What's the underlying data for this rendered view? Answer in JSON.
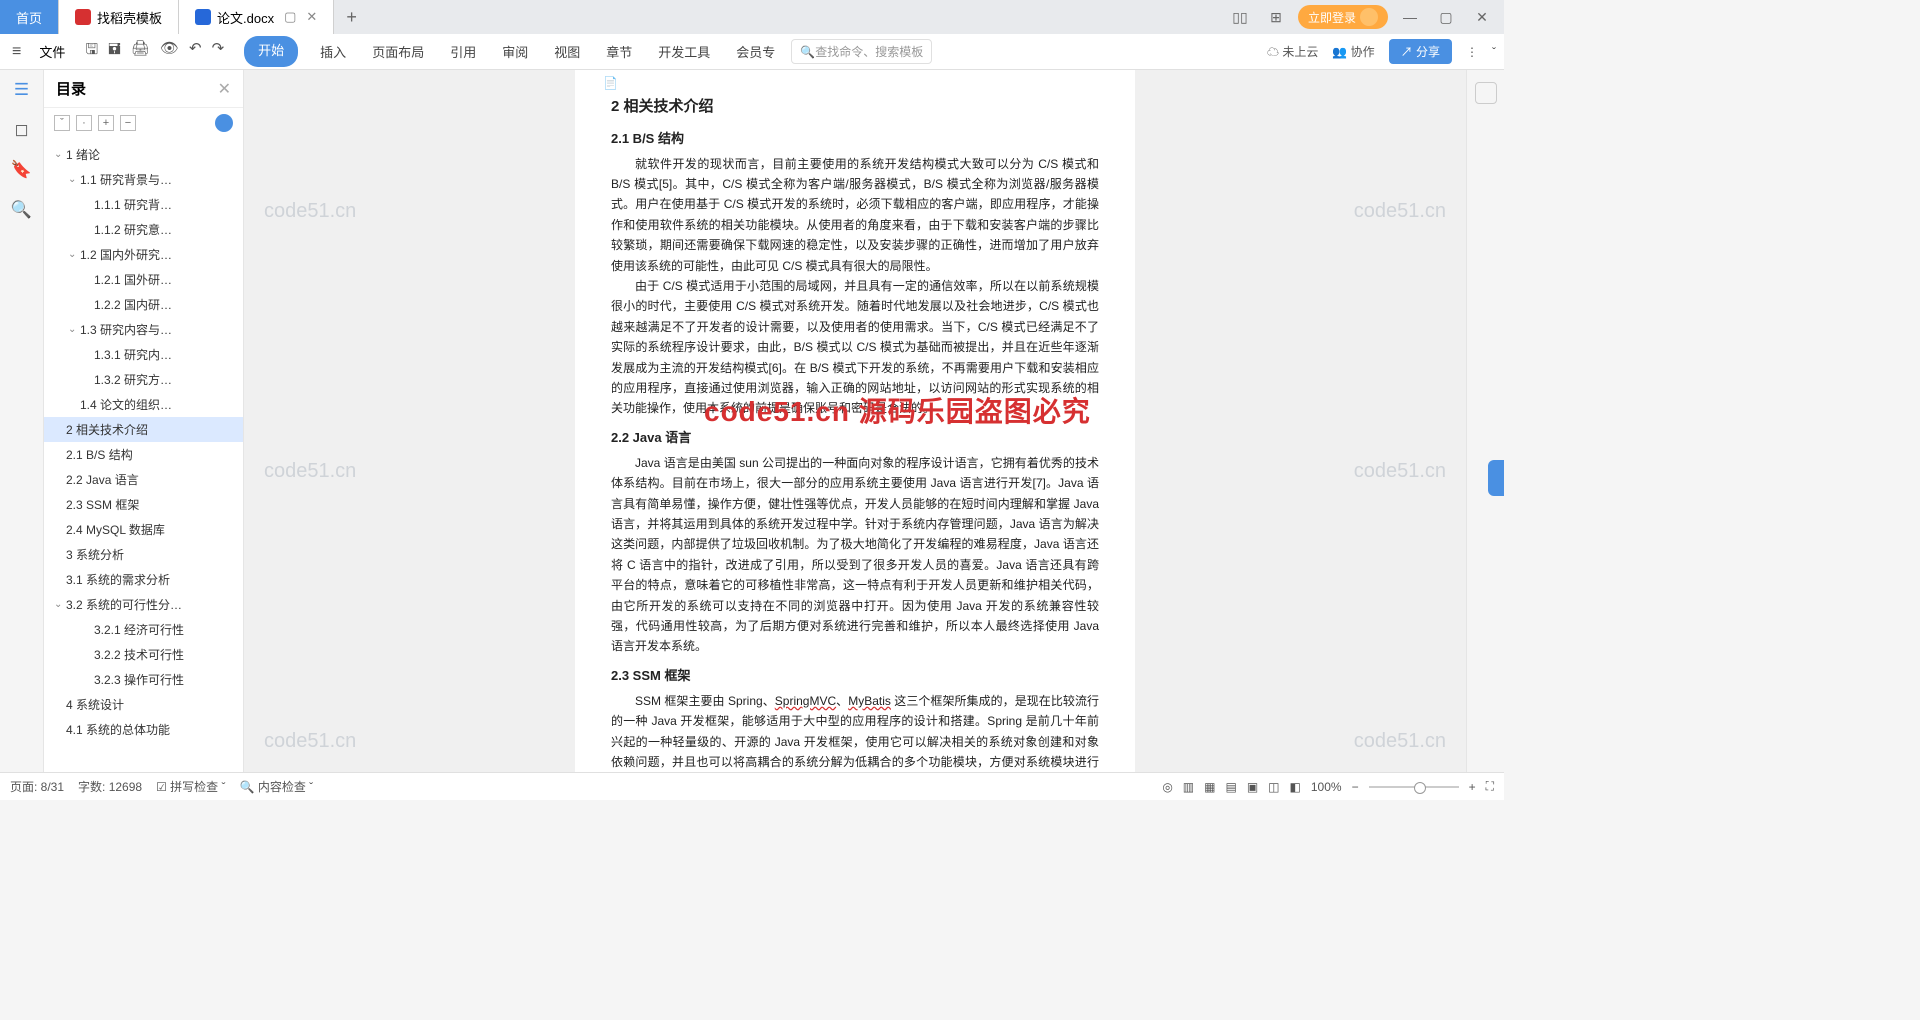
{
  "tabs": {
    "home": "首页",
    "template": "找稻壳模板",
    "doc": "论文.docx"
  },
  "login": "立即登录",
  "ribbon": {
    "file": "文件",
    "tabs": [
      "开始",
      "插入",
      "页面布局",
      "引用",
      "审阅",
      "视图",
      "章节",
      "开发工具",
      "会员专"
    ],
    "search_ph": "查找命令、搜索模板",
    "cloud": "未上云",
    "collab": "协作",
    "share": "分享"
  },
  "outline": {
    "title": "目录",
    "items": [
      {
        "t": "1 绪论",
        "l": 0,
        "c": 1
      },
      {
        "t": "1.1 研究背景与…",
        "l": 1,
        "c": 1
      },
      {
        "t": "1.1.1 研究背…",
        "l": 2
      },
      {
        "t": "1.1.2 研究意…",
        "l": 2
      },
      {
        "t": "1.2 国内外研究…",
        "l": 1,
        "c": 1
      },
      {
        "t": "1.2.1 国外研…",
        "l": 2
      },
      {
        "t": "1.2.2 国内研…",
        "l": 2
      },
      {
        "t": "1.3 研究内容与…",
        "l": 1,
        "c": 1
      },
      {
        "t": "1.3.1 研究内…",
        "l": 2
      },
      {
        "t": "1.3.2 研究方…",
        "l": 2
      },
      {
        "t": "1.4 论文的组织…",
        "l": 1
      },
      {
        "t": "2 相关技术介绍",
        "l": 0,
        "sel": 1
      },
      {
        "t": "2.1 B/S 结构",
        "l": 0
      },
      {
        "t": "2.2 Java 语言",
        "l": 0
      },
      {
        "t": "2.3 SSM 框架",
        "l": 0
      },
      {
        "t": "2.4 MySQL 数据库",
        "l": 0
      },
      {
        "t": "3 系统分析",
        "l": 0
      },
      {
        "t": "3.1 系统的需求分析",
        "l": 0
      },
      {
        "t": "3.2 系统的可行性分…",
        "l": 0,
        "c": 1
      },
      {
        "t": "3.2.1 经济可行性",
        "l": 2
      },
      {
        "t": "3.2.2 技术可行性",
        "l": 2
      },
      {
        "t": "3.2.3 操作可行性",
        "l": 2
      },
      {
        "t": "4 系统设计",
        "l": 0
      },
      {
        "t": "4.1 系统的总体功能",
        "l": 0
      }
    ]
  },
  "doc": {
    "h1": "2 相关技术介绍",
    "s21_h": "2.1 B/S 结构",
    "s21_p1": "就软件开发的现状而言，目前主要使用的系统开发结构模式大致可以分为 C/S 模式和 B/S 模式[5]。其中，C/S 模式全称为客户端/服务器模式，B/S 模式全称为浏览器/服务器模式。用户在使用基于 C/S 模式开发的系统时，必须下载相应的客户端，即应用程序，才能操作和使用软件系统的相关功能模块。从使用者的角度来看，由于下载和安装客户端的步骤比较繁琐，期间还需要确保下载网速的稳定性，以及安装步骤的正确性，进而增加了用户放弃使用该系统的可能性，由此可见 C/S 模式具有很大的局限性。",
    "s21_p2_a": "由于 C/S 模式适用于小范围的局域网，并且具有一定的通信效率，所以在以前系统规模很小的时代，主要使用 C/S 模式对系统开发。随着时代地发展以及社会地进步，C/S 模式也越来越满足不了开发者的设计需要，以及使用者的使用需求。当下，C/S 模式已经满足不了实际的系统程序设计要求，由此，B/S 模式以 C/S 模式为基础而被提出，并且在近些年逐渐发展成为主流的开发结构模式[6]。在 B/S 模式下开发的系统，不再需要用户下载和安装相应的应用程序，直接通过使用浏览器，输入正确的网站地址，以访问网站的形式实现系统的相关功能操作，",
    "s21_p2_b": "使用本系统的前提是确保账号和密码是合法的。",
    "s22_h": "2.2 Java 语言",
    "s22_p": "Java 语言是由美国 sun 公司提出的一种面向对象的程序设计语言，它拥有着优秀的技术体系结构。目前在市场上，很大一部分的应用系统主要使用 Java 语言进行开发[7]。Java 语言具有简单易懂，操作方便，健壮性强等优点，开发人员能够的在短时间内理解和掌握 Java 语言，并将其运用到具体的系统开发过程中学。针对于系统内存管理问题，Java 语言为解决这类问题，内部提供了垃圾回收机制。为了极大地简化了开发编程的难易程度，Java 语言还将 C 语言中的指针，改进成了引用，所以受到了很多开发人员的喜爱。Java 语言还具有跨平台的特点，意味着它的可移植性非常高，这一特点有利于开发人员更新和维护相关代码，由它所开发的系统可以支持在不同的浏览器中打开。因为使用 Java 开发的系统兼容性较强，代码通用性较高，为了后期方便对系统进行完善和维护，所以本人最终选择使用 Java 语言开发本系统。",
    "s23_h": "2.3 SSM 框架",
    "s23_p_a": "SSM 框架主要由 Spring、",
    "s23_w1": "SpringMVC",
    "s23_sep": "、",
    "s23_w2": "MyBatis",
    "s23_p_b": " 这三个框架所集成的，是现在比较流行的一种 Java 开发框架，能够适用于大中型的应用程序的设计和搭建。Spring 是前几十年前兴起的一种轻量级的、开源的 Java 开发框架，使用它可以解决相关的系统对象创建和对象依赖问题，并且也可以将高耦合的系统分解为低耦合的多个功能模块，方便对系统模块进行明确的分工，对功能代码进行理解和"
  },
  "overlay": "code51.cn 源码乐园盗图必究",
  "watermark": "code51.cn",
  "status": {
    "page": "页面: 8/31",
    "words": "字数: 12698",
    "spell": "拼写检查",
    "content": "内容检查",
    "zoom": "100%"
  }
}
